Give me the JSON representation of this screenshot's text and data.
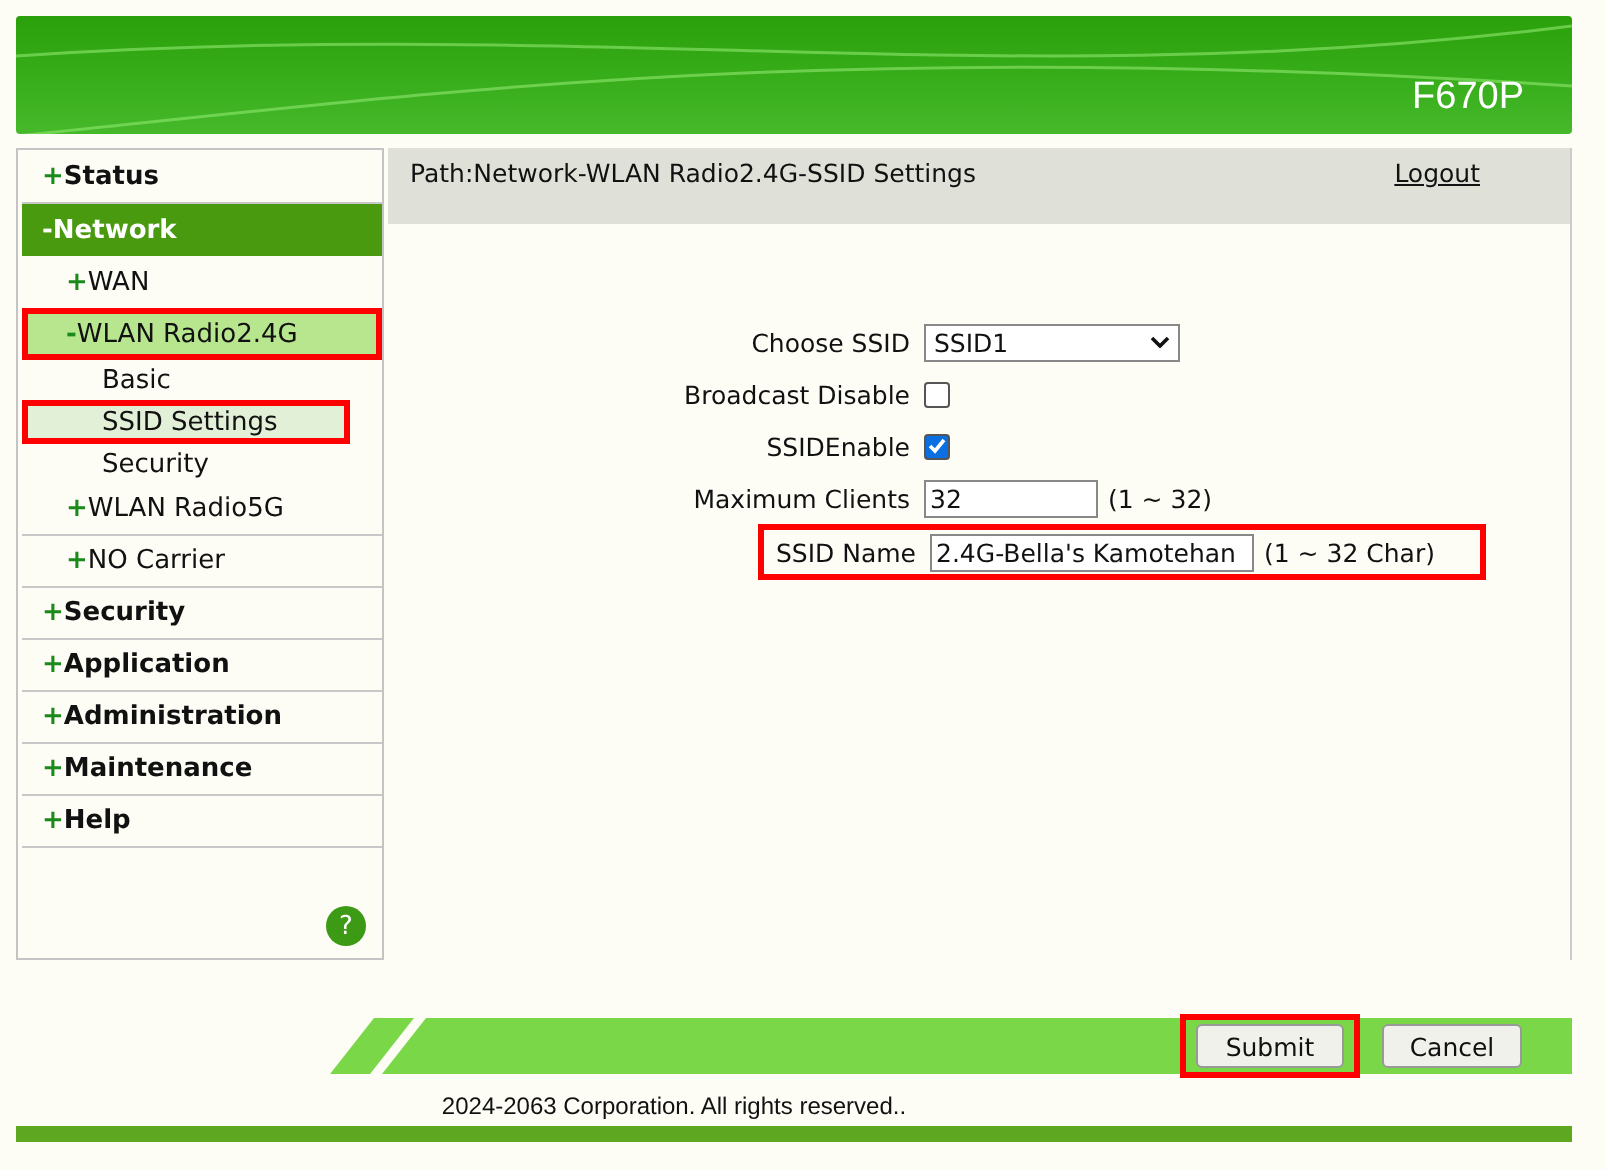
{
  "header": {
    "model": "F670P"
  },
  "sidebar": {
    "items": [
      {
        "sign": "+",
        "label": "Status",
        "selected": false,
        "annotated": false
      },
      {
        "sign": "-",
        "label": "Network",
        "selected": true,
        "annotated": false,
        "children": [
          {
            "sign": "+",
            "label": "WAN",
            "selected": false,
            "annotated": false
          },
          {
            "sign": "-",
            "label": "WLAN Radio2.4G",
            "selected": true,
            "annotated": true,
            "children": [
              {
                "label": "Basic",
                "selected": false,
                "annotated": false
              },
              {
                "label": "SSID Settings",
                "selected": true,
                "annotated": true
              },
              {
                "label": "Security",
                "selected": false,
                "annotated": false
              }
            ]
          },
          {
            "sign": "+",
            "label": "WLAN Radio5G",
            "selected": false,
            "annotated": false
          },
          {
            "sign": "+",
            "label": "NO Carrier",
            "selected": false,
            "annotated": false
          }
        ]
      },
      {
        "sign": "+",
        "label": "Security",
        "selected": false,
        "annotated": false
      },
      {
        "sign": "+",
        "label": "Application",
        "selected": false,
        "annotated": false
      },
      {
        "sign": "+",
        "label": "Administration",
        "selected": false,
        "annotated": false
      },
      {
        "sign": "+",
        "label": "Maintenance",
        "selected": false,
        "annotated": false
      },
      {
        "sign": "+",
        "label": "Help",
        "selected": false,
        "annotated": false
      }
    ],
    "help": "?"
  },
  "path": "Path:Network-WLAN Radio2.4G-SSID Settings",
  "logout": "Logout",
  "form": [
    {
      "kind": "select",
      "label": "Choose SSID",
      "value": "SSID1",
      "annotated": false
    },
    {
      "kind": "checkbox",
      "label": "Broadcast Disable",
      "checked": false,
      "annotated": false
    },
    {
      "kind": "checkbox",
      "label": "SSIDEnable",
      "checked": true,
      "annotated": false
    },
    {
      "kind": "text",
      "label": "Maximum Clients",
      "value": "32",
      "hint": "(1 ~ 32)",
      "annotated": false
    },
    {
      "kind": "text",
      "label": "SSID Name",
      "value": "2.4G-Bella's Kamotehan",
      "hint": "(1 ~ 32 Char)",
      "annotated": true
    }
  ],
  "buttons": [
    {
      "label": "Submit",
      "annotated": true
    },
    {
      "label": "Cancel",
      "annotated": false
    }
  ],
  "footer": "2024-2063 Corporation. All rights reserved.."
}
